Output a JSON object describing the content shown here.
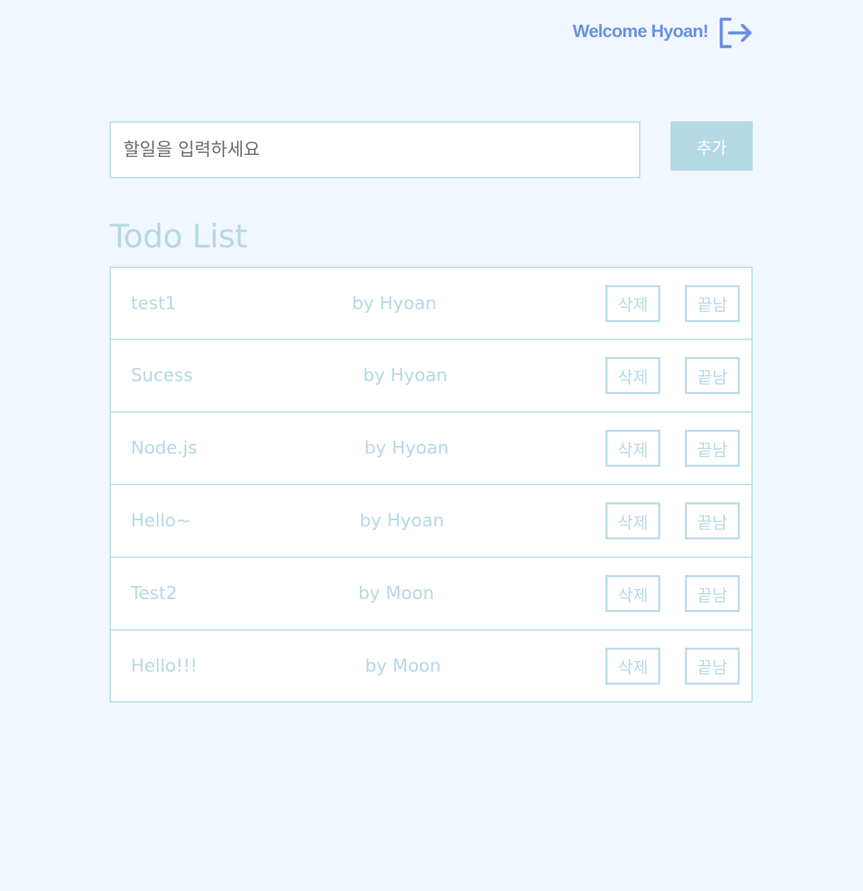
{
  "header": {
    "welcome_text": "Welcome Hyoan!",
    "logout_icon": "logout-icon",
    "accent_color": "#6b8fe0"
  },
  "add_form": {
    "placeholder": "할일을 입력하세요",
    "value": "",
    "add_label": "추가"
  },
  "list": {
    "title": "Todo List",
    "items": [
      {
        "text": "test1",
        "author": "by Hyoan",
        "delete_label": "삭제",
        "done_label": "끝남"
      },
      {
        "text": "Sucess",
        "author": "by Hyoan",
        "delete_label": "삭제",
        "done_label": "끝남"
      },
      {
        "text": "Node.js",
        "author": "by Hyoan",
        "delete_label": "삭제",
        "done_label": "끝남"
      },
      {
        "text": "Hello~",
        "author": "by Hyoan",
        "delete_label": "삭제",
        "done_label": "끝남"
      },
      {
        "text": "Test2",
        "author": "by Moon",
        "delete_label": "삭제",
        "done_label": "끝남"
      },
      {
        "text": "Hello!!!",
        "author": "by Moon",
        "delete_label": "삭제",
        "done_label": "끝남"
      }
    ]
  },
  "colors": {
    "background": "#f0f7ff",
    "primary_light": "#b5d8e5",
    "border": "#bcdde8"
  }
}
